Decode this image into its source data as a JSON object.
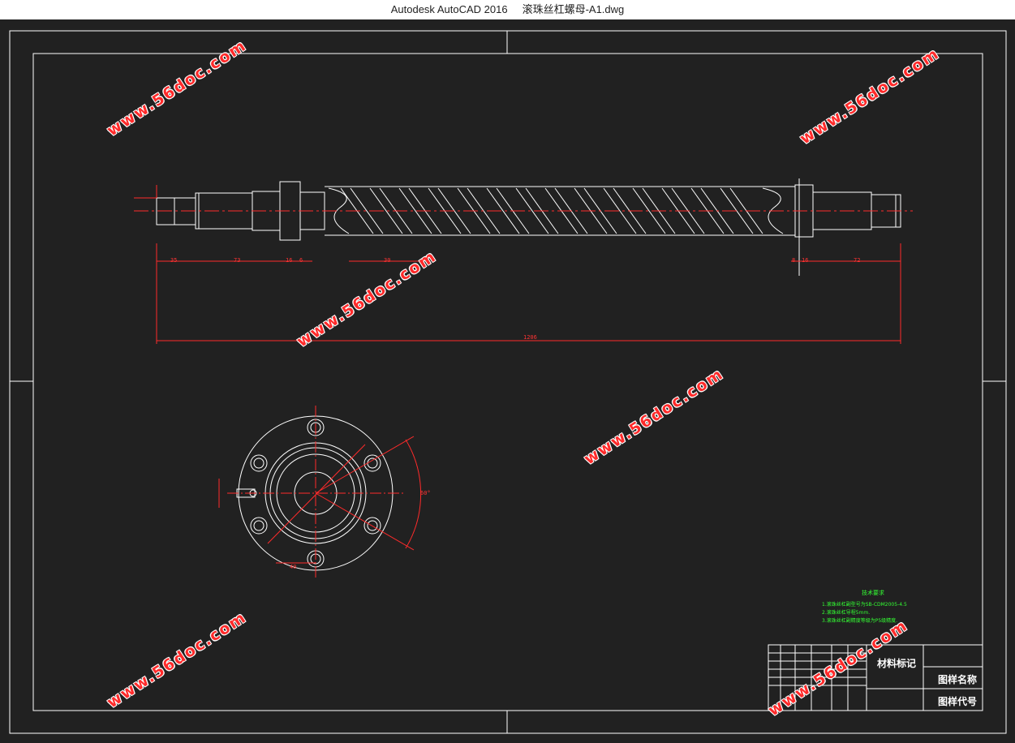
{
  "window": {
    "app": "Autodesk AutoCAD 2016",
    "file": "滚珠丝杠螺母-A1.dwg"
  },
  "watermark": "www.56doc.com",
  "drawing": {
    "dims": {
      "d_35": "35",
      "d_73": "73",
      "d_16a": "16",
      "d_6": "6",
      "d_30": "30",
      "d_8": "8",
      "d_16b": "16",
      "d_72": "72",
      "d_total": "1206",
      "angle": "60°",
      "d_40": "40"
    },
    "tech_req": {
      "title": "技术要求",
      "lines": [
        "1.滚珠丝杠副型号为SB-CDM2005-4.5",
        "2.滚珠丝杠导程5mm.",
        "3.滚珠丝杠副精度等级为P5级精度."
      ]
    },
    "title_block": {
      "material": "材料标记",
      "drawing_name": "图样名称",
      "drawing_code": "图样代号"
    }
  },
  "colors": {
    "background": "#212121",
    "frame": "#ffffff",
    "dimension": "#ff2b2b",
    "text_green": "#33ff33",
    "centerline": "#ff2b2b"
  }
}
